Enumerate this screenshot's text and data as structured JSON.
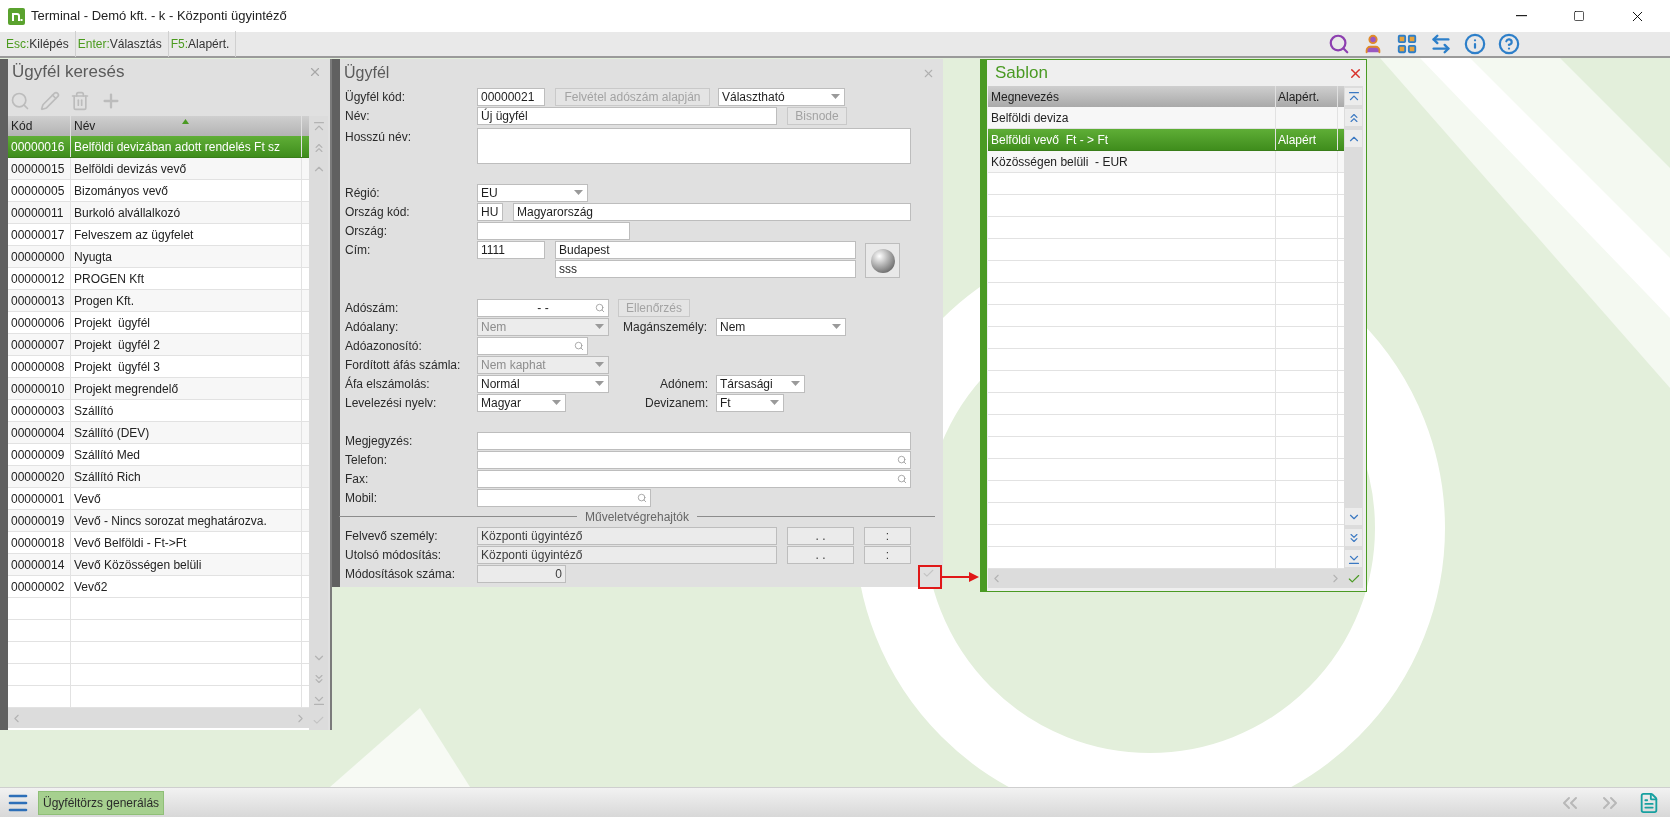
{
  "window": {
    "title": "Terminal - Demó kft. - k - Központi ügyintéző"
  },
  "shortcuts": [
    {
      "key": "Esc:",
      "label": "Kilépés"
    },
    {
      "key": "Enter:",
      "label": "Választás"
    },
    {
      "key": "F5:",
      "label": "Alapért."
    }
  ],
  "search_panel": {
    "title": "Ügyfél keresés",
    "columns": [
      "Kód",
      "Név"
    ],
    "rows": [
      {
        "code": "00000016",
        "name": "Belföldi devizában adott rendelés Ft sz",
        "selected": true
      },
      {
        "code": "00000015",
        "name": "Belföldi devizás vevő",
        "selected": false
      },
      {
        "code": "00000005",
        "name": "Bizományos vevő",
        "selected": false
      },
      {
        "code": "00000011",
        "name": "Burkoló alvállalkozó",
        "selected": false
      },
      {
        "code": "00000017",
        "name": "Felveszem az ügyfelet",
        "selected": false
      },
      {
        "code": "00000000",
        "name": "Nyugta",
        "selected": false
      },
      {
        "code": "00000012",
        "name": "PROGEN Kft",
        "selected": false
      },
      {
        "code": "00000013",
        "name": "Progen Kft.",
        "selected": false
      },
      {
        "code": "00000006",
        "name": "Projekt  ügyfél",
        "selected": false
      },
      {
        "code": "00000007",
        "name": "Projekt  ügyfél 2",
        "selected": false
      },
      {
        "code": "00000008",
        "name": "Projekt  ügyfél 3",
        "selected": false
      },
      {
        "code": "00000010",
        "name": "Projekt megrendelő",
        "selected": false
      },
      {
        "code": "00000003",
        "name": "Szállító",
        "selected": false
      },
      {
        "code": "00000004",
        "name": "Szállító (DEV)",
        "selected": false
      },
      {
        "code": "00000009",
        "name": "Szállító Med",
        "selected": false
      },
      {
        "code": "00000020",
        "name": "Szállító Rich",
        "selected": false
      },
      {
        "code": "00000001",
        "name": "Vevő",
        "selected": false
      },
      {
        "code": "00000019",
        "name": "Vevő - Nincs sorozat meghatározva.",
        "selected": false
      },
      {
        "code": "00000018",
        "name": "Vevő Belföldi - Ft->Ft",
        "selected": false
      },
      {
        "code": "00000014",
        "name": "Vevő Közösségen belüli",
        "selected": false
      },
      {
        "code": "00000002",
        "name": "Vevő2",
        "selected": false
      }
    ]
  },
  "form": {
    "title": "Ügyfél",
    "code": {
      "label": "Ügyfél kód:",
      "value": "00000021"
    },
    "lookup_button": {
      "label": "Felvétel adószám alapján",
      "disabled": true
    },
    "status": {
      "value": "Választható",
      "disabled": false
    },
    "name": {
      "label": "Név:",
      "value": "Új ügyfél"
    },
    "bisnode_button": {
      "label": "Bisnode",
      "disabled": true
    },
    "long_name": {
      "label": "Hosszú név:"
    },
    "region": {
      "label": "Régió:",
      "value": "EU",
      "disabled": false
    },
    "country_code": {
      "label": "Ország kód:",
      "code": "HU",
      "name": "Magyarország"
    },
    "country": {
      "label": "Ország:"
    },
    "address": {
      "label": "Cím:",
      "zip": "1111",
      "city": "Budapest",
      "street": "sss"
    },
    "tax_number": {
      "label": "Adószám:",
      "value": "- -"
    },
    "check_button": {
      "label": "Ellenőrzés",
      "disabled": true
    },
    "tax_subject": {
      "label": "Adóalany:",
      "value": "Nem",
      "disabled": true
    },
    "private_person": {
      "label": "Magánszemély:",
      "value": "Nem",
      "disabled": false
    },
    "tax_id": {
      "label": "Adóazonosító:"
    },
    "reverse_vat": {
      "label": "Fordított áfás számla:",
      "value": "Nem kaphat",
      "disabled": true
    },
    "vat_accounting": {
      "label": "Áfa elszámolás:",
      "value": "Normál",
      "disabled": false
    },
    "tax_type": {
      "label": "Adónem:",
      "value": "Társasági",
      "disabled": false
    },
    "language": {
      "label": "Levelezési nyelv:",
      "value": "Magyar",
      "disabled": false
    },
    "currency": {
      "label": "Devizanem:",
      "value": "Ft",
      "disabled": false
    },
    "note": {
      "label": "Megjegyzés:"
    },
    "phone": {
      "label": "Telefon:"
    },
    "fax": {
      "label": "Fax:"
    },
    "mobile": {
      "label": "Mobil:"
    },
    "audit_title": "Műveletvégrehajtók",
    "created_by": {
      "label": "Felvevő személy:",
      "value": "Központi ügyintéző",
      "date": ". .",
      "time": ":"
    },
    "modified_by": {
      "label": "Utolsó módosítás:",
      "value": "Központi ügyintéző",
      "date": ". .",
      "time": ":"
    },
    "modification_count": {
      "label": "Módosítások száma:",
      "value": "0"
    }
  },
  "template_panel": {
    "title": "Sablon",
    "columns": [
      "Megnevezés",
      "Alapért."
    ],
    "rows": [
      {
        "name": "Belföldi deviza",
        "selected": false
      },
      {
        "name": "Belföldi vevő  Ft - > Ft",
        "default": "Alapért",
        "selected": true
      },
      {
        "name": "Közösségen belüli  - EUR",
        "selected": false
      }
    ]
  },
  "bottom_bar": {
    "tab": "Ügyféltörzs generálás"
  }
}
